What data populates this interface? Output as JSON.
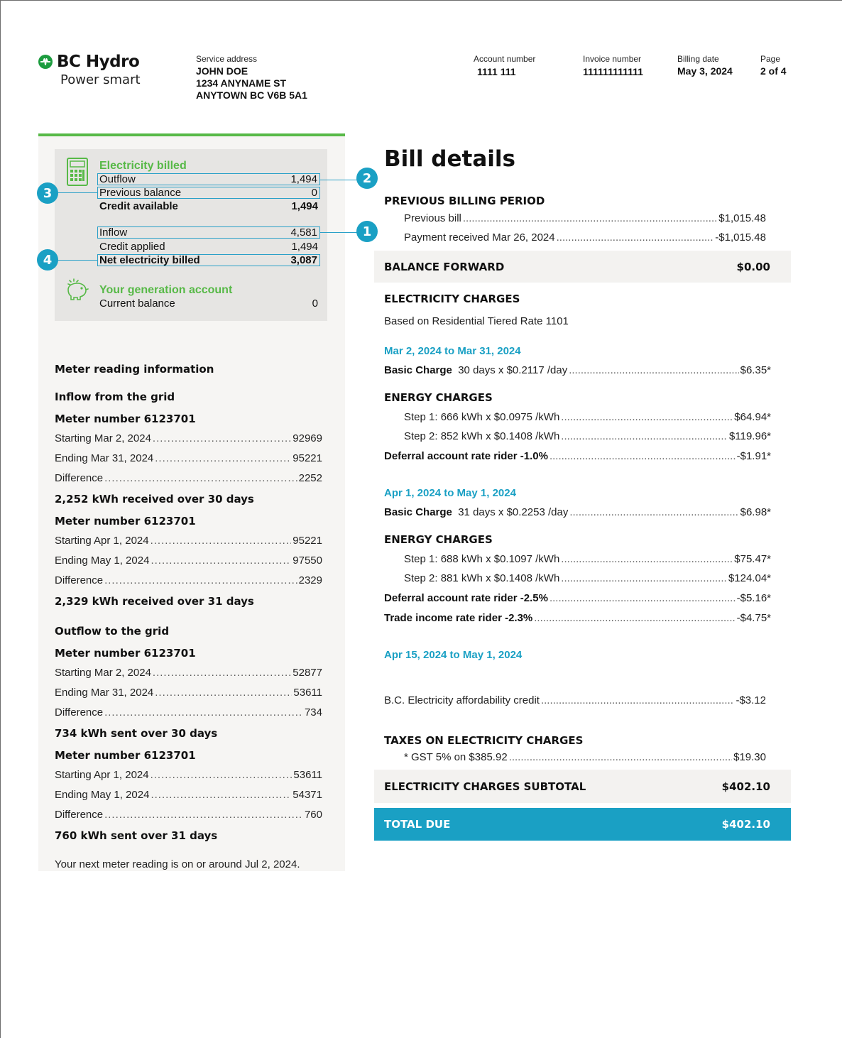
{
  "brand": {
    "name": "BC Hydro",
    "tagline": "Power smart"
  },
  "header": {
    "service_address_label": "Service address",
    "address_lines": [
      "JOHN DOE",
      "1234 ANYNAME ST",
      "ANYTOWN BC  V6B 5A1"
    ],
    "account_label": "Account number",
    "account_value": "1111 111",
    "invoice_label": "Invoice number",
    "invoice_value": "111111111111",
    "billing_label": "Billing date",
    "billing_value": "May 3, 2024",
    "page_label": "Page",
    "page_value": "2 of 4"
  },
  "summary": {
    "electricity_billed_title": "Electricity billed",
    "rows": [
      {
        "label": "Outflow",
        "value": "1,494"
      },
      {
        "label": "Previous balance",
        "value": "0"
      },
      {
        "label": "Credit available",
        "value": "1,494"
      },
      {
        "label": "Inflow",
        "value": "4,581"
      },
      {
        "label": "Credit applied",
        "value": "1,494"
      },
      {
        "label": "Net electricity billed",
        "value": "3,087"
      }
    ],
    "generation_title": "Your generation account",
    "current_balance_label": "Current balance",
    "current_balance_value": "0"
  },
  "callouts": [
    "2",
    "3",
    "1",
    "4"
  ],
  "meter": {
    "title": "Meter reading information",
    "inflow_title": "Inflow from the grid",
    "outflow_title": "Outflow to the grid",
    "blocks": [
      {
        "meter": "Meter number 6123701",
        "rows": [
          [
            "Starting Mar 2, 2024",
            "92969"
          ],
          [
            "Ending Mar 31, 2024",
            "95221"
          ],
          [
            "Difference",
            "2252"
          ]
        ],
        "summary": "2,252 kWh received over 30 days"
      },
      {
        "meter": "Meter number 6123701",
        "rows": [
          [
            "Starting Apr 1, 2024",
            "95221"
          ],
          [
            "Ending May 1, 2024",
            "97550"
          ],
          [
            "Difference",
            "2329"
          ]
        ],
        "summary": "2,329 kWh received over 31 days"
      },
      {
        "meter": "Meter number 6123701",
        "rows": [
          [
            "Starting Mar 2, 2024",
            "52877"
          ],
          [
            "Ending Mar 31, 2024",
            "53611"
          ],
          [
            "Difference",
            "734"
          ]
        ],
        "summary": "734 kWh sent over 30 days"
      },
      {
        "meter": "Meter number 6123701",
        "rows": [
          [
            "Starting Apr 1, 2024",
            "53611"
          ],
          [
            "Ending May 1, 2024",
            "54371"
          ],
          [
            "Difference",
            "760"
          ]
        ],
        "summary": "760 kWh sent over 31 days"
      }
    ],
    "next_reading": "Your next meter reading is on or around Jul 2, 2024."
  },
  "bill": {
    "title": "Bill details",
    "prev_period_title": "PREVIOUS BILLING PERIOD",
    "previous_bill_label": "Previous bill",
    "previous_bill_value": "$1,015.48",
    "payment_label": "Payment received Mar 26, 2024",
    "payment_value": "-$1,015.48",
    "balance_forward_label": "BALANCE FORWARD",
    "balance_forward_value": "$0.00",
    "charges_title": "ELECTRICITY CHARGES",
    "rate_note": "Based on Residential Tiered Rate 1101",
    "energy_title": "ENERGY CHARGES",
    "p1": {
      "range": "Mar 2, 2024 to Mar 31, 2024",
      "basic_label": "Basic Charge",
      "basic_detail": "30 days x $0.2117 /day",
      "basic_value": "$6.35*",
      "step1": "Step 1:  666 kWh x $0.0975 /kWh",
      "step1_value": "$64.94*",
      "step2": "Step 2:  852 kWh x $0.1408 /kWh",
      "step2_value": "$119.96*",
      "deferral_label": "Deferral account rate rider -1.0%",
      "deferral_value": "-$1.91*"
    },
    "p2": {
      "range": "Apr 1, 2024 to May 1, 2024",
      "basic_label": "Basic Charge",
      "basic_detail": "31 days x $0.2253 /day",
      "basic_value": "$6.98*",
      "step1": "Step 1:  688 kWh x $0.1097 /kWh",
      "step1_value": "$75.47*",
      "step2": "Step 2:  881 kWh x $0.1408 /kWh",
      "step2_value": "$124.04*",
      "deferral_label": "Deferral account rate rider -2.5%",
      "deferral_value": "-$5.16*",
      "trade_label": "Trade income rate rider -2.3%",
      "trade_value": "-$4.75*"
    },
    "p3": {
      "range": "Apr 15, 2024 to May 1, 2024",
      "credit_label": "B.C. Electricity affordability credit",
      "credit_value": "-$3.12"
    },
    "taxes_title": "TAXES ON ELECTRICITY CHARGES",
    "gst_label": "* GST 5% on $385.92",
    "gst_value": "$19.30",
    "subtotal_label": "ELECTRICITY CHARGES SUBTOTAL",
    "subtotal_value": "$402.10",
    "total_label": "TOTAL DUE",
    "total_value": "$402.10"
  }
}
